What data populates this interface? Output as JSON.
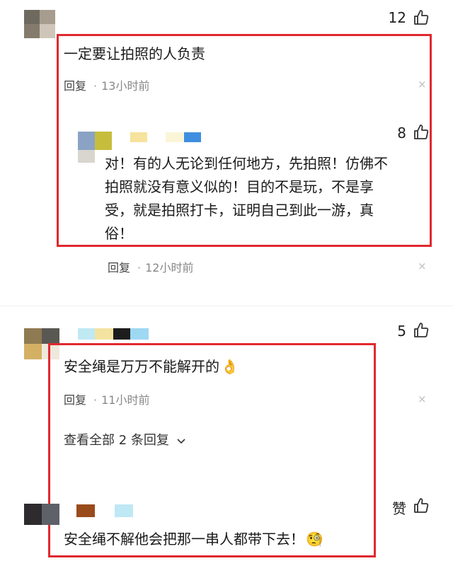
{
  "comments": [
    {
      "id": "c1",
      "text": "一定要让拍照的人负责",
      "reply_label": "回复",
      "dot": "·",
      "time": "13小时前",
      "likes": "12",
      "close": "×"
    },
    {
      "id": "c1r1",
      "lines": [
        "对！有的人无论到任何地方，先拍照！仿佛不",
        "拍照就没有意义似的！目的不是玩，不是享",
        "受，就是拍照打卡，证明自己到此一游，真",
        "俗！"
      ],
      "reply_label": "回复",
      "dot": "·",
      "time": "12小时前",
      "likes": "8",
      "close": "×"
    },
    {
      "id": "c2",
      "text": "安全绳是万万不能解开的",
      "emoji": "👌",
      "reply_label": "回复",
      "dot": "·",
      "time": "11小时前",
      "likes": "5",
      "close": "×",
      "expand_label": "查看全部 2 条回复",
      "expand_icon": "chevron-down-icon"
    },
    {
      "id": "c2r1",
      "text": "安全绳不解他会把那一串人都带下去！",
      "emoji": "🧐",
      "likes": "赞"
    }
  ],
  "colors": {
    "highlight": "#e0282f",
    "meta": "#888888"
  }
}
